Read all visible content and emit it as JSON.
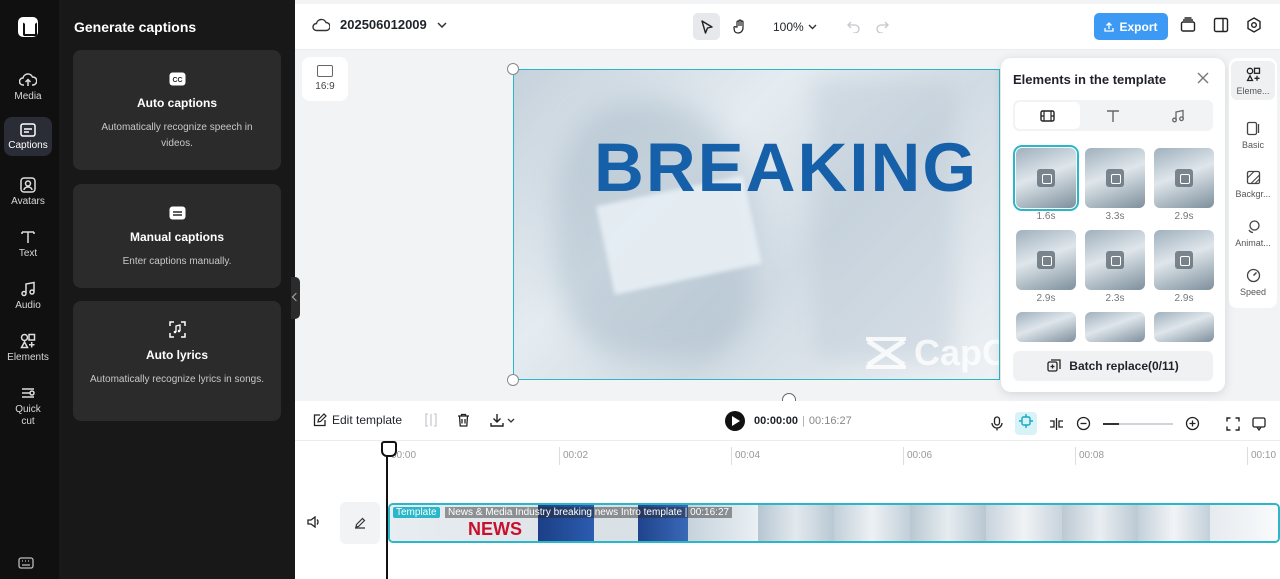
{
  "app": {
    "project_name": "202506012009",
    "zoom": "100%",
    "export_label": "Export"
  },
  "rail": [
    {
      "label": "Media",
      "icon": "cloud-upload-icon"
    },
    {
      "label": "Captions",
      "icon": "captions-icon",
      "active": true
    },
    {
      "label": "Avatars",
      "icon": "avatar-icon"
    },
    {
      "label": "Text",
      "icon": "text-icon"
    },
    {
      "label": "Audio",
      "icon": "music-note-icon"
    },
    {
      "label": "Elements",
      "icon": "shapes-icon"
    },
    {
      "label": "Quick cut",
      "icon": "quick-cut-icon"
    }
  ],
  "captions_panel": {
    "title": "Generate captions",
    "cards": [
      {
        "title": "Auto captions",
        "desc": "Automatically recognize speech in videos.",
        "icon": "cc-icon"
      },
      {
        "title": "Manual captions",
        "desc": "Enter captions manually.",
        "icon": "keyboard-caption-icon"
      },
      {
        "title": "Auto lyrics",
        "desc": "Automatically recognize lyrics in songs.",
        "icon": "lyrics-scan-icon"
      }
    ]
  },
  "canvas": {
    "ratio": "16:9",
    "headline": "BREAKING",
    "watermark": "CapC"
  },
  "elements_panel": {
    "title": "Elements in the template",
    "tabs": [
      "video-tab-icon",
      "text-tab-icon",
      "audio-tab-icon"
    ],
    "thumbs": [
      {
        "duration": "1.6s"
      },
      {
        "duration": "3.3s"
      },
      {
        "duration": "2.9s"
      },
      {
        "duration": "2.9s"
      },
      {
        "duration": "2.3s"
      },
      {
        "duration": "2.9s"
      },
      {
        "duration": ""
      },
      {
        "duration": ""
      },
      {
        "duration": ""
      }
    ],
    "batch_label": "Batch replace(0/11)"
  },
  "properties": [
    {
      "label": "Eleme...",
      "active": true
    },
    {
      "label": "Basic"
    },
    {
      "label": "Backgr..."
    },
    {
      "label": "Animat..."
    },
    {
      "label": "Speed"
    }
  ],
  "timeline": {
    "edit_template": "Edit template",
    "current_time": "00:00:00",
    "total_time": "00:16:27",
    "ruler": [
      "00:00",
      "00:02",
      "00:04",
      "00:06",
      "00:08",
      "00:10"
    ],
    "track_tag": "Template",
    "track_name": "News & Media Industry breaking news Intro template | 00:16:27",
    "track_overlay_text": "NEWS",
    "colors": {
      "accent": "#2ab7c9",
      "export": "#3c9af5"
    }
  }
}
